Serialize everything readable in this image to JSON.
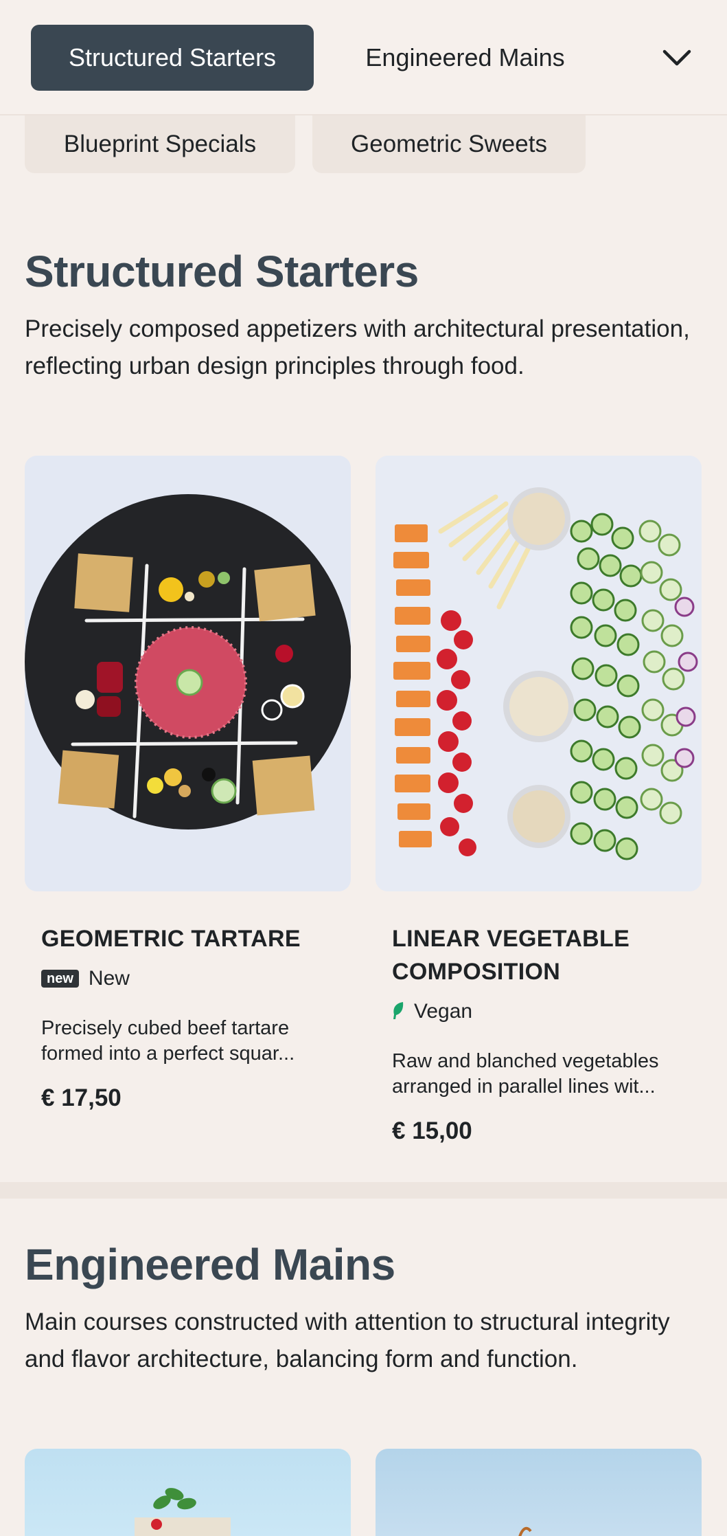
{
  "nav": {
    "tabs": [
      "Structured Starters",
      "Engineered Mains",
      "Blueprint Specials",
      "Geometric Sweets"
    ],
    "active_tab": "Structured Starters",
    "more_icon": "chevron-down-icon"
  },
  "sections": [
    {
      "title": "Structured Starters",
      "description": "Precisely composed appetizers with architectural presentation, reflecting urban design principles through food.",
      "items": [
        {
          "name": "GEOMETRIC TARTARE",
          "badge_tag": "new",
          "badge_label": "New",
          "description": "Precisely cubed beef tartare formed into a perfect squar...",
          "price": "€ 17,50"
        },
        {
          "name": "LINEAR VEGETABLE COMPOSITION",
          "badge_icon": "leaf-icon",
          "badge_label": "Vegan",
          "description": "Raw and blanched vegetables arranged in parallel lines wit...",
          "price": "€ 15,00"
        }
      ]
    },
    {
      "title": "Engineered Mains",
      "description": "Main courses constructed with attention to structural integrity and flavor architecture, balancing form and function."
    }
  ],
  "colors": {
    "background": "#f5efeb",
    "accent": "#3a4752",
    "vegan_green": "#1aa56b"
  }
}
